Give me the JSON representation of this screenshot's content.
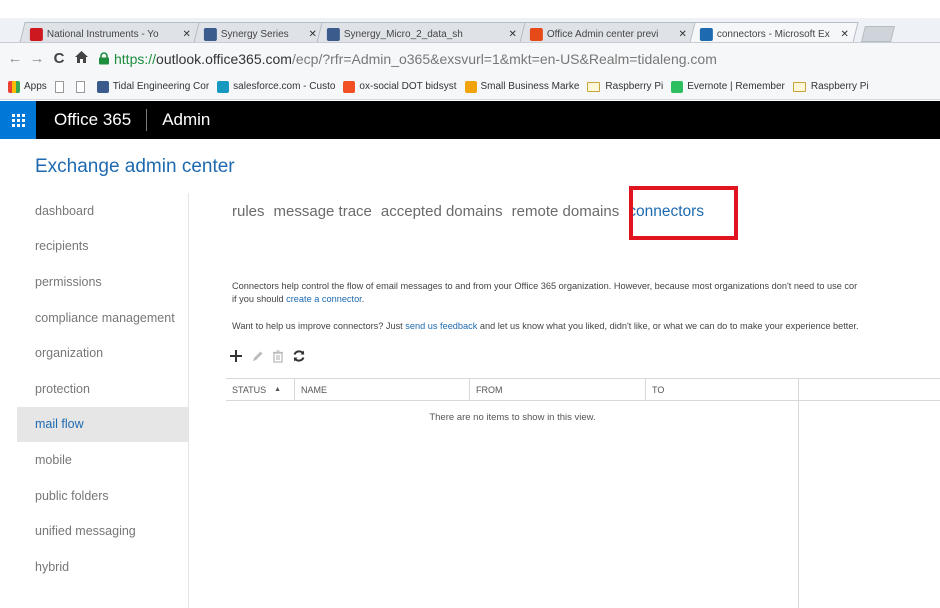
{
  "browser": {
    "tabs": [
      {
        "title": "National Instruments - Yo",
        "icon": "youtube-icon",
        "color": "#cc181e"
      },
      {
        "title": "Synergy Series",
        "icon": "tidal-icon",
        "color": "#3b5b8c"
      },
      {
        "title": "Synergy_Micro_2_data_sh",
        "icon": "tidal-icon",
        "color": "#3b5b8c"
      },
      {
        "title": "Office Admin center previ",
        "icon": "office-icon",
        "color": "#e64a19"
      },
      {
        "title": "connectors - Microsoft Ex",
        "icon": "exchange-icon",
        "color": "#1e6ab0"
      }
    ],
    "url_https": "https://",
    "url_host": "outlook.office365.com",
    "url_rest": "/ecp/?rfr=Admin_o365&exsvurl=1&mkt=en-US&Realm=tidaleng.com",
    "bookmarks": [
      {
        "label": "Apps",
        "icon": "apps-icon",
        "color": "#4285f4"
      },
      {
        "label": "",
        "icon": "page-icon",
        "color": "#999999"
      },
      {
        "label": "",
        "icon": "page-icon",
        "color": "#999999"
      },
      {
        "label": "Tidal Engineering Cor",
        "icon": "tidal-icon",
        "color": "#3b5b8c"
      },
      {
        "label": "salesforce.com - Custo",
        "icon": "salesforce-icon",
        "color": "#1798c1"
      },
      {
        "label": "ox-social DOT bidsyst",
        "icon": "windows-icon",
        "color": "#f25022"
      },
      {
        "label": "Small Business Marke",
        "icon": "constant-contact-icon",
        "color": "#f0a30a"
      },
      {
        "label": "Raspberry Pi",
        "icon": "folder-icon",
        "color": "#c8a43a"
      },
      {
        "label": "Evernote | Remember",
        "icon": "evernote-icon",
        "color": "#2dbe60"
      },
      {
        "label": "Raspberry Pi",
        "icon": "folder-icon",
        "color": "#c8a43a"
      }
    ]
  },
  "o365": {
    "title": "Office 365",
    "admin": "Admin",
    "accent": "#0078d7"
  },
  "eac": {
    "title": "Exchange admin center",
    "sidebar": [
      {
        "label": "dashboard",
        "active": false
      },
      {
        "label": "recipients",
        "active": false
      },
      {
        "label": "permissions",
        "active": false
      },
      {
        "label": "compliance management",
        "active": false
      },
      {
        "label": "organization",
        "active": false
      },
      {
        "label": "protection",
        "active": false
      },
      {
        "label": "mail flow",
        "active": true
      },
      {
        "label": "mobile",
        "active": false
      },
      {
        "label": "public folders",
        "active": false
      },
      {
        "label": "unified messaging",
        "active": false
      },
      {
        "label": "hybrid",
        "active": false
      }
    ],
    "subnav": [
      {
        "label": "rules",
        "active": false
      },
      {
        "label": "message trace",
        "active": false
      },
      {
        "label": "accepted domains",
        "active": false
      },
      {
        "label": "remote domains",
        "active": false
      },
      {
        "label": "connectors",
        "active": true
      }
    ],
    "desc1": "Connectors help control the flow of email messages to and from your Office 365 organization. However, because most organizations don't need to use cor",
    "desc1_link_pre": "if you should ",
    "desc1_link": "create a connector",
    "desc1_link_post": ".",
    "desc2_pre": "Want to help us improve connectors? Just ",
    "desc2_link": "send us feedback",
    "desc2_post": " and let us know what you liked, didn't like, or what we can do to make your experience better.",
    "columns": {
      "status": "STATUS",
      "name": "NAME",
      "from": "FROM",
      "to": "TO"
    },
    "empty_message": "There are no items to show in this view.",
    "highlight_color": "#e0141e"
  }
}
